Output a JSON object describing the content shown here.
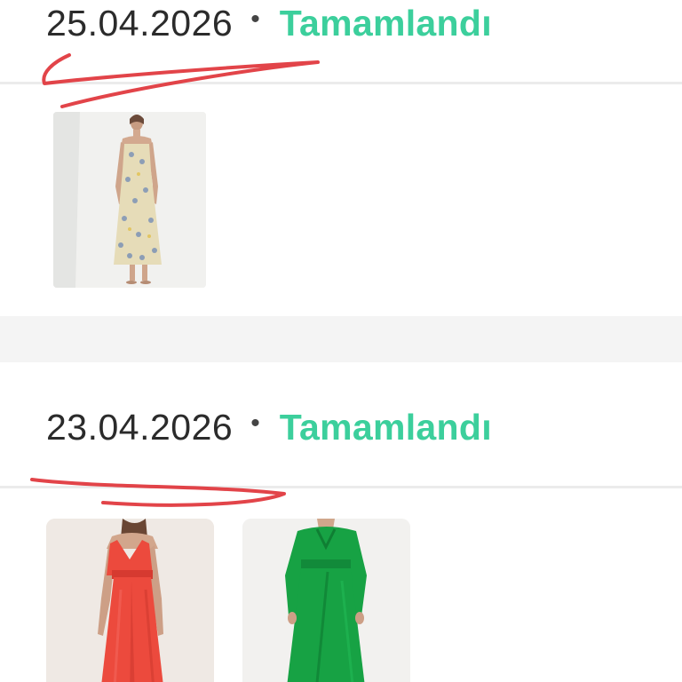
{
  "orders": [
    {
      "date": "25.04.2026",
      "separator": "•",
      "status": "Tamamlandı",
      "status_color": "#3ccf9c",
      "items": [
        {
          "image": "floral-print-slip-maxi-dress",
          "dress_color": "#e6dcb8"
        }
      ]
    },
    {
      "date": "23.04.2026",
      "separator": "•",
      "status": "Tamamlandı",
      "status_color": "#3ccf9c",
      "items": [
        {
          "image": "coral-red-satin-maxi-dress",
          "dress_color": "#ec4a3d"
        },
        {
          "image": "green-wrap-midi-dress",
          "dress_color": "#17a244"
        }
      ]
    }
  ],
  "annotation_color": "#e0343a"
}
